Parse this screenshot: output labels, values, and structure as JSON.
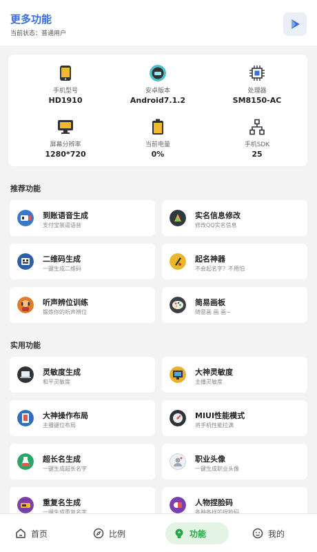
{
  "header": {
    "title": "更多功能",
    "status": "当前状态：普通用户"
  },
  "device": [
    {
      "label": "手机型号",
      "value": "HD1910",
      "icon": "phone-icon"
    },
    {
      "label": "安卓版本",
      "value": "Android7.1.2",
      "icon": "android-icon"
    },
    {
      "label": "处理器",
      "value": "SM8150-AC",
      "icon": "cpu-icon"
    },
    {
      "label": "屏幕分辨率",
      "value": "1280*720",
      "icon": "monitor-icon"
    },
    {
      "label": "当前电量",
      "value": "0%",
      "icon": "battery-icon"
    },
    {
      "label": "手机SDK",
      "value": "25",
      "icon": "sdk-icon"
    }
  ],
  "sections": {
    "recommended": "推荐功能",
    "practical": "实用功能"
  },
  "recommended": [
    {
      "title": "到账语音生成",
      "desc": "支付宝装逼语音",
      "color": "#3a78c9",
      "icon": "voice-icon"
    },
    {
      "title": "实名信息修改",
      "desc": "修改QQ实名信息",
      "color": "#2f3a3f",
      "icon": "id-icon"
    },
    {
      "title": "二维码生成",
      "desc": "一键生成二维码",
      "color": "#2c5fa8",
      "icon": "qrcode-icon"
    },
    {
      "title": "起名神器",
      "desc": "不会起名字？不用怕",
      "color": "#e8b82a",
      "icon": "name-icon"
    },
    {
      "title": "听声辨位训练",
      "desc": "锻炼你的听声辨位",
      "color": "#e07a2c",
      "icon": "listen-icon"
    },
    {
      "title": "简易画板",
      "desc": "随意画 画 画~",
      "color": "#3b3f46",
      "icon": "palette-icon"
    }
  ],
  "practical": [
    {
      "title": "灵敏度生成",
      "desc": "和平灵敏度",
      "color": "#2f3338",
      "icon": "laptop-icon"
    },
    {
      "title": "大神灵敏度",
      "desc": "主播灵敏度",
      "color": "#e6b22d",
      "icon": "screen-icon"
    },
    {
      "title": "大神操作布局",
      "desc": "主播键位布局",
      "color": "#2f6fc0",
      "icon": "layout-icon"
    },
    {
      "title": "MIUI性能模式",
      "desc": "将手机性能拉满",
      "color": "#2f3338",
      "icon": "performance-icon"
    },
    {
      "title": "超长名生成",
      "desc": "一键生成超长名字",
      "color": "#2aa56a",
      "icon": "longname-icon"
    },
    {
      "title": "职业头像",
      "desc": "一键生成职业头像",
      "color": "#dde3e8",
      "icon": "avatar-icon"
    },
    {
      "title": "重复名生成",
      "desc": "一键生成重复名字",
      "color": "#7b3fa8",
      "icon": "repeat-icon"
    },
    {
      "title": "人物捏脸码",
      "desc": "各种各样的捏脸码",
      "color": "#7a3fb0",
      "icon": "face-icon"
    }
  ],
  "nav": [
    {
      "label": "首页",
      "icon": "home-icon"
    },
    {
      "label": "比例",
      "icon": "compass-icon"
    },
    {
      "label": "功能",
      "icon": "bulb-icon"
    },
    {
      "label": "我的",
      "icon": "smile-icon"
    }
  ],
  "colors": {
    "accent": "#3b6fe0",
    "nav_active": "#27a745",
    "nav_active_bg": "#e3f4e4"
  }
}
